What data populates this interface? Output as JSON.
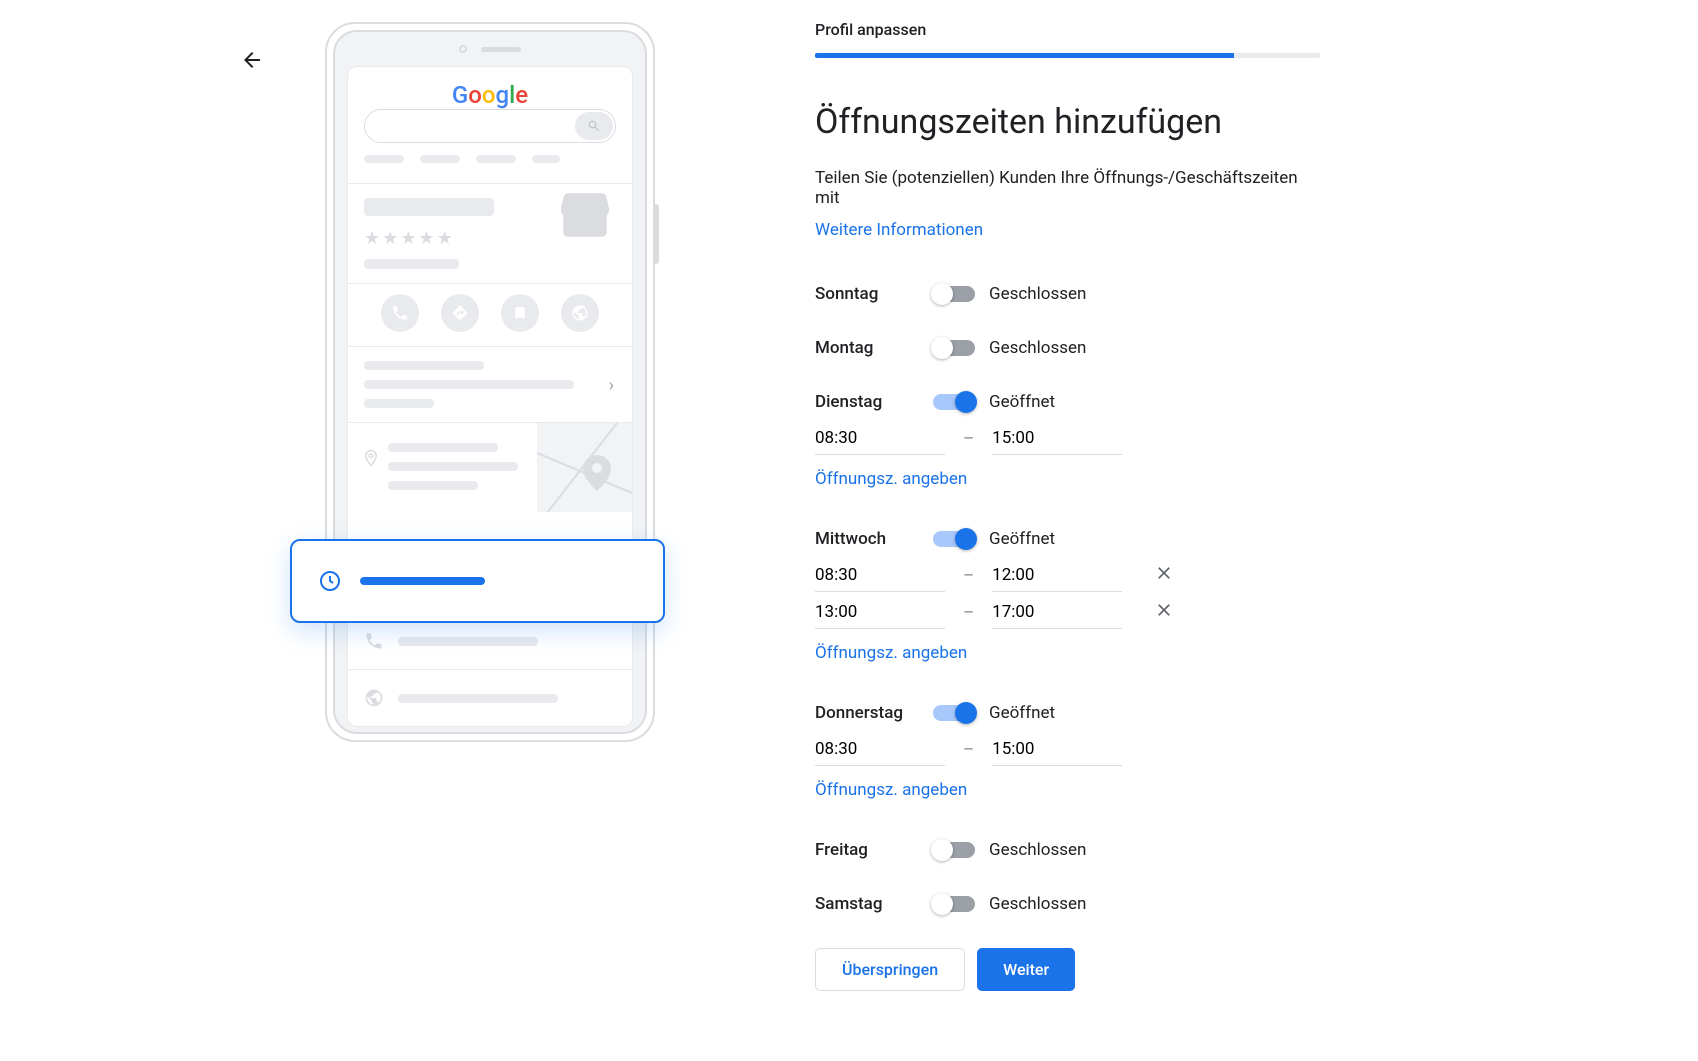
{
  "header": {
    "step_label": "Profil anpassen",
    "progress_percent": 83
  },
  "page": {
    "title": "Öffnungszeiten hinzufügen",
    "subtitle": "Teilen Sie (potenziellen) Kunden Ihre Öffnungs-/Geschäftszeiten mit",
    "info_link": "Weitere Informationen"
  },
  "labels": {
    "closed": "Geschlossen",
    "open": "Geöffnet",
    "add_hours": "Öffnungsz. angeben",
    "time_separator": "–"
  },
  "days": [
    {
      "name": "Sonntag",
      "open": false,
      "slots": []
    },
    {
      "name": "Montag",
      "open": false,
      "slots": []
    },
    {
      "name": "Dienstag",
      "open": true,
      "slots": [
        {
          "from": "08:30",
          "to": "15:00"
        }
      ]
    },
    {
      "name": "Mittwoch",
      "open": true,
      "slots": [
        {
          "from": "08:30",
          "to": "12:00"
        },
        {
          "from": "13:00",
          "to": "17:00"
        }
      ]
    },
    {
      "name": "Donnerstag",
      "open": true,
      "slots": [
        {
          "from": "08:30",
          "to": "15:00"
        }
      ]
    },
    {
      "name": "Freitag",
      "open": false,
      "slots": []
    },
    {
      "name": "Samstag",
      "open": false,
      "slots": []
    }
  ],
  "actions": {
    "skip": "Überspringen",
    "next": "Weiter"
  },
  "illustration": {
    "logo": "Google"
  }
}
